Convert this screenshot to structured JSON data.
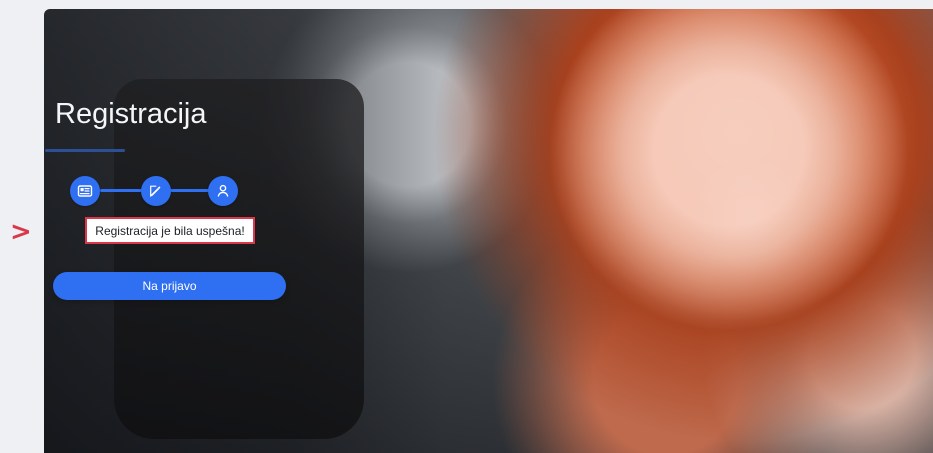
{
  "page": {
    "title": "Registracija",
    "success_message": "Registracija je bila uspešna!",
    "button_label": "Na prijavo",
    "indicator": ">"
  },
  "steps": [
    {
      "name": "document-step",
      "icon": "id-card-icon"
    },
    {
      "name": "edit-step",
      "icon": "edit-icon"
    },
    {
      "name": "profile-step",
      "icon": "user-icon"
    }
  ],
  "colors": {
    "accent": "#2f6ff2",
    "highlight": "#d9384b"
  }
}
